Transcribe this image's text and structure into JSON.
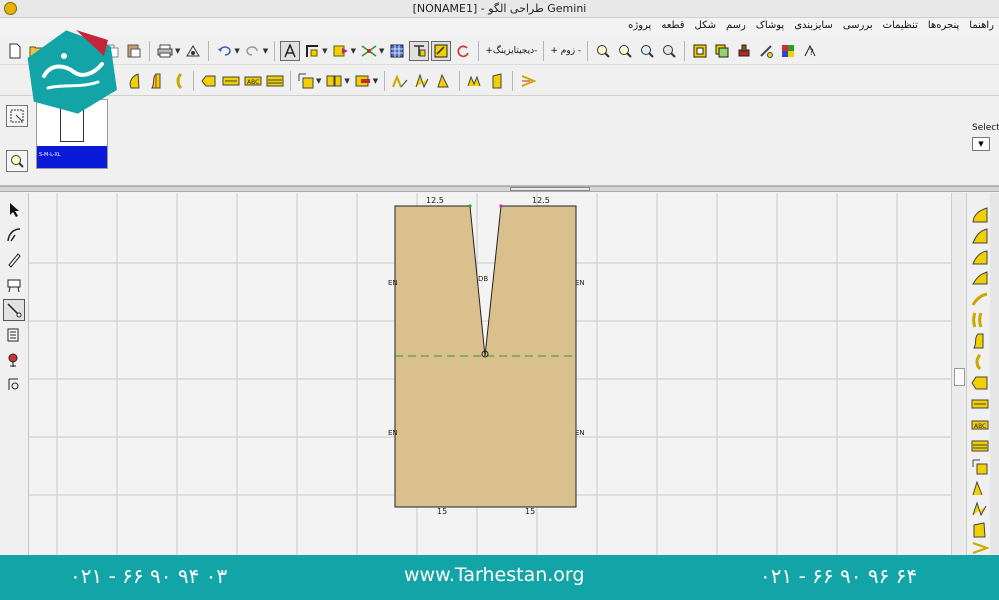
{
  "title": "[NONAME1] - طراحی الگو Gemini",
  "menu": [
    "پروژه",
    "قطعه",
    "شکل",
    "رسم",
    "پوشاک",
    "سایزبندی",
    "بررسی",
    "تنظیمات",
    "پنجره‌ها",
    "راهنما"
  ],
  "toolbar": {
    "stitch_label": "+دیجیتایزینگ-",
    "zoom_label": "+ زوم -",
    "plus_label": "+"
  },
  "preview": {
    "select_label": "Selecte",
    "thumb_caption": "S-M-L-XL"
  },
  "pattern": {
    "top_left_label": "12.5",
    "top_right_label": "12.5",
    "bottom_left_label": "15",
    "bottom_right_label": "15"
  },
  "footer": {
    "phone_left": "۰۲۱ - ۶۶ ۹۰ ۹۴ ۰۳",
    "website": "www.Tarhestan.org",
    "phone_right": "۰۲۱ - ۶۶ ۹۰ ۹۶ ۶۴"
  },
  "colors": {
    "pattern_fill": "#d9c08c",
    "footer_bg": "#13a4a8",
    "logo_bg": "#13a4a8",
    "logo_accent": "#c7233a",
    "toolbar_highlight": "#f0d000",
    "dashed_line": "#2aa12a"
  },
  "icons": {
    "app": "gemini-app-icon",
    "logo": "tarhestan-logo"
  }
}
